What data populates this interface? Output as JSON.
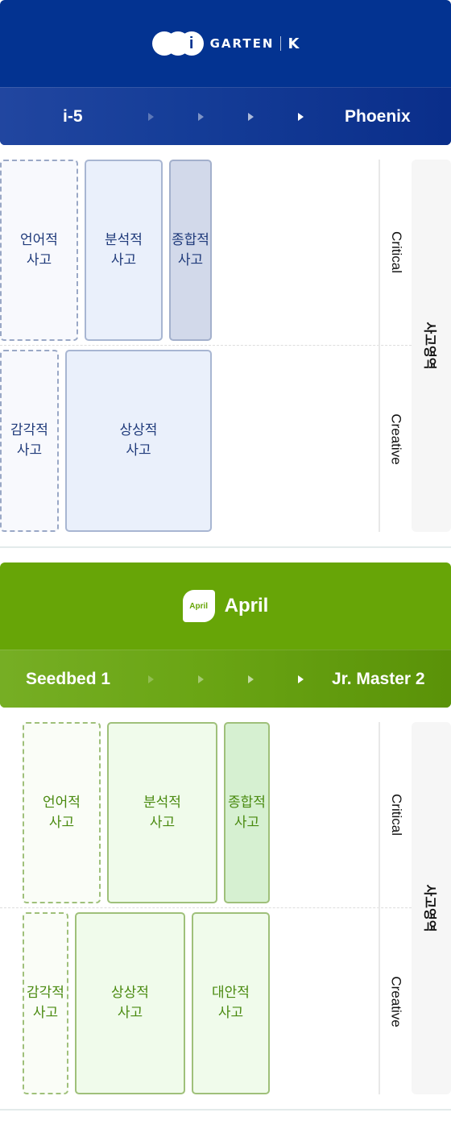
{
  "garten": {
    "brand": {
      "logo_letter": "i",
      "name": "GARTEN",
      "k_mark": "K"
    },
    "levels": {
      "start": "i-5",
      "end": "Phoenix",
      "arrow_count": 4
    },
    "side_title": "사고영역",
    "rows": {
      "critical": "Critical",
      "creative": "Creative"
    },
    "boxes": {
      "verbal": "언어적\n사고",
      "analytical": "분석적\n사고",
      "synthetic": "종합적\n사고",
      "sensory": "감각적\n사고",
      "imaginative": "상상적\n사고"
    },
    "colors": {
      "header": "#033391",
      "text": "#1f3a7a"
    }
  },
  "april": {
    "brand": {
      "badge_text": "April",
      "name": "April"
    },
    "levels": {
      "start": "Seedbed 1",
      "end": "Jr. Master 2",
      "arrow_count": 4
    },
    "side_title": "사고영역",
    "rows": {
      "critical": "Critical",
      "creative": "Creative"
    },
    "boxes": {
      "verbal": "언어적\n사고",
      "analytical": "분석적\n사고",
      "synthetic": "종합적\n사고",
      "sensory": "감각적\n사고",
      "imaginative": "상상적\n사고",
      "alternative": "대안적\n사고"
    },
    "colors": {
      "header": "#67a507",
      "text": "#4a8a10"
    }
  }
}
